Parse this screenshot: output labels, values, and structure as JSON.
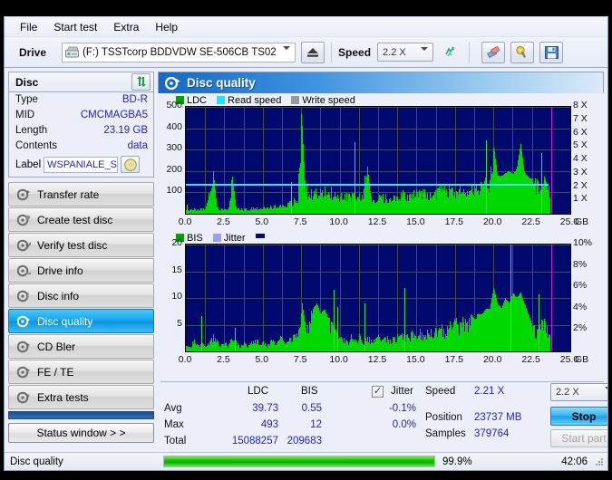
{
  "menu": {
    "items": [
      "File",
      "Start test",
      "Extra",
      "Help"
    ]
  },
  "toolbar": {
    "drive_label": "Drive",
    "drive_value": "(F:)  TSSTcorp BDDVDW SE-506CB TS02",
    "speed_label": "Speed",
    "speed_value": "2.2 X",
    "eject_icon": "eject-icon",
    "refresh_icon": "refresh-icon",
    "erase_icon": "erase-icon",
    "settings_icon": "settings-icon",
    "save_icon": "save-icon"
  },
  "disc": {
    "title": "Disc",
    "refresh_icon": "disc-refresh-icon",
    "rows": [
      {
        "key": "Type",
        "value": "BD-R"
      },
      {
        "key": "MID",
        "value": "CMCMAGBA5"
      },
      {
        "key": "Length",
        "value": "23.19 GB"
      },
      {
        "key": "Contents",
        "value": "data"
      }
    ],
    "label_key": "Label",
    "label_value": "WSPANIALE_S",
    "label_icon": "cd-icon"
  },
  "sidebar": {
    "items": [
      {
        "label": "Transfer rate",
        "icon": "disc-transfer-icon",
        "selected": false
      },
      {
        "label": "Create test disc",
        "icon": "disc-create-icon",
        "selected": false
      },
      {
        "label": "Verify test disc",
        "icon": "disc-verify-icon",
        "selected": false
      },
      {
        "label": "Drive info",
        "icon": "drive-info-icon",
        "selected": false
      },
      {
        "label": "Disc info",
        "icon": "disc-info-icon",
        "selected": false
      },
      {
        "label": "Disc quality",
        "icon": "disc-quality-icon",
        "selected": true
      },
      {
        "label": "CD Bler",
        "icon": "cd-bler-icon",
        "selected": false
      },
      {
        "label": "FE / TE",
        "icon": "fe-te-icon",
        "selected": false
      },
      {
        "label": "Extra tests",
        "icon": "extra-tests-icon",
        "selected": false
      }
    ],
    "status_window_button": "Status window > >"
  },
  "panel": {
    "title": "Disc quality",
    "title_icon": "disc-quality-icon"
  },
  "stats": {
    "col_ldc": "LDC",
    "col_bis": "BIS",
    "col_jitter": "Jitter",
    "jitter_checked": true,
    "rows": [
      {
        "name": "Avg",
        "ldc": "39.73",
        "bis": "0.55",
        "jitter": "-0.1%"
      },
      {
        "name": "Max",
        "ldc": "493",
        "bis": "12",
        "jitter": "0.0%"
      },
      {
        "name": "Total",
        "ldc": "15088257",
        "bis": "209683",
        "jitter": ""
      }
    ],
    "speed_key": "Speed",
    "speed_value": "2.21 X",
    "position_key": "Position",
    "position_value": "23737 MB",
    "samples_key": "Samples",
    "samples_value": "379764",
    "speed_select": "2.2 X",
    "stop_button": "Stop",
    "start_part_button": "Start part"
  },
  "statusbar": {
    "text": "Disc quality",
    "percent": "99.9%",
    "progress": 99.9,
    "time": "42:06"
  },
  "colors": {
    "ldc": "#00d900",
    "bis": "#2bd400",
    "read_speed": "#3fe0ff",
    "write_speed": "#9a9a9a",
    "jitter": "#9aa0f0",
    "plot_bg": "#000a6e",
    "accent": "#1668c2",
    "value_text": "#2222cc"
  },
  "chart_data": [
    {
      "type": "area",
      "title": "LDC",
      "xlabel": "GB",
      "ylabel": "LDC",
      "xlim": [
        0,
        25
      ],
      "ylim": [
        0,
        500
      ],
      "y2lim": [
        0,
        8
      ],
      "y2label": "X",
      "xticks": [
        "0.0",
        "2.5",
        "5.0",
        "7.5",
        "10.0",
        "12.5",
        "15.0",
        "17.5",
        "20.0",
        "22.5",
        "25.0"
      ],
      "yticks": [
        100,
        200,
        300,
        400,
        500
      ],
      "y2ticks": [
        "1 X",
        "2 X",
        "3 X",
        "4 X",
        "5 X",
        "6 X",
        "7 X",
        "8 X"
      ],
      "x_unit_label": "GB",
      "grid": true,
      "legend": [
        {
          "name": "LDC",
          "color": "#00a000"
        },
        {
          "name": "Read speed",
          "color": "#18e8ff"
        },
        {
          "name": "Write speed",
          "color": "#9a9a9a"
        }
      ],
      "legend_position": "top-left",
      "read_speed_constant": 2.21,
      "cursor_x": 23.74,
      "series": [
        {
          "name": "LDC",
          "x": [
            0.0,
            0.25,
            0.5,
            0.75,
            1.0,
            1.25,
            1.5,
            1.75,
            2.0,
            2.25,
            2.5,
            2.75,
            3.0,
            3.25,
            3.5,
            3.75,
            4.0,
            4.25,
            4.5,
            4.75,
            5.0,
            5.25,
            5.5,
            5.75,
            6.0,
            6.25,
            6.5,
            6.75,
            7.0,
            7.25,
            7.5,
            7.75,
            8.0,
            8.25,
            8.5,
            8.75,
            9.0,
            9.25,
            9.5,
            9.75,
            10.0,
            10.25,
            10.5,
            10.75,
            11.0,
            11.25,
            11.5,
            11.75,
            12.0,
            12.25,
            12.5,
            12.75,
            13.0,
            13.25,
            13.5,
            13.75,
            14.0,
            14.25,
            14.5,
            14.75,
            15.0,
            15.25,
            15.5,
            15.75,
            16.0,
            16.25,
            16.5,
            16.75,
            17.0,
            17.25,
            17.5,
            17.75,
            18.0,
            18.25,
            18.5,
            18.75,
            19.0,
            19.25,
            19.5,
            19.75,
            20.0,
            20.25,
            20.5,
            20.75,
            21.0,
            21.25,
            21.5,
            21.75,
            22.0,
            22.25,
            22.5,
            22.75,
            23.0,
            23.25,
            23.5,
            23.74
          ],
          "values": [
            18,
            20,
            22,
            20,
            24,
            22,
            95,
            215,
            30,
            24,
            22,
            26,
            180,
            28,
            26,
            24,
            22,
            26,
            28,
            30,
            32,
            30,
            34,
            36,
            38,
            42,
            46,
            52,
            60,
            75,
            480,
            120,
            115,
            110,
            130,
            125,
            140,
            118,
            112,
            105,
            100,
            98,
            95,
            92,
            90,
            88,
            86,
            250,
            84,
            86,
            88,
            90,
            86,
            84,
            88,
            92,
            96,
            98,
            102,
            100,
            104,
            108,
            106,
            110,
            112,
            108,
            114,
            118,
            116,
            120,
            124,
            128,
            126,
            130,
            134,
            138,
            140,
            145,
            150,
            160,
            320,
            180,
            175,
            190,
            200,
            185,
            210,
            330,
            195,
            170,
            160,
            140,
            150,
            180,
            130,
            120
          ]
        },
        {
          "name": "Read speed",
          "x": [
            0.0,
            23.6
          ],
          "values": [
            2.21,
            2.21
          ],
          "color": "#3fe0ff"
        }
      ]
    },
    {
      "type": "area",
      "title": "BIS",
      "xlabel": "GB",
      "ylabel": "BIS",
      "xlim": [
        0,
        25
      ],
      "ylim": [
        0,
        20
      ],
      "y2lim": [
        0,
        10
      ],
      "y2label": "%",
      "xticks": [
        "0.0",
        "2.5",
        "5.0",
        "7.5",
        "10.0",
        "12.5",
        "15.0",
        "17.5",
        "20.0",
        "22.5",
        "25.0"
      ],
      "yticks": [
        5,
        10,
        15,
        20
      ],
      "y2ticks": [
        "2%",
        "4%",
        "6%",
        "8%",
        "10%"
      ],
      "x_unit_label": "GB",
      "grid": true,
      "legend": [
        {
          "name": "BIS",
          "color": "#00a000"
        },
        {
          "name": "Jitter",
          "color": "#9aa0f0"
        }
      ],
      "legend_position": "top-left",
      "cursor_x": 23.74,
      "series": [
        {
          "name": "BIS",
          "x": [
            0.0,
            0.25,
            0.5,
            0.75,
            1.0,
            1.25,
            1.5,
            1.75,
            2.0,
            2.25,
            2.5,
            2.75,
            3.0,
            3.25,
            3.5,
            3.75,
            4.0,
            4.25,
            4.5,
            4.75,
            5.0,
            5.25,
            5.5,
            5.75,
            6.0,
            6.25,
            6.5,
            6.75,
            7.0,
            7.25,
            7.5,
            7.75,
            8.0,
            8.25,
            8.5,
            8.75,
            9.0,
            9.25,
            9.5,
            9.75,
            10.0,
            10.25,
            10.5,
            10.75,
            11.0,
            11.25,
            11.5,
            11.75,
            12.0,
            12.25,
            12.5,
            12.75,
            13.0,
            13.25,
            13.5,
            13.75,
            14.0,
            14.25,
            14.5,
            14.75,
            15.0,
            15.25,
            15.5,
            15.75,
            16.0,
            16.25,
            16.5,
            16.75,
            17.0,
            17.25,
            17.5,
            17.75,
            18.0,
            18.25,
            18.5,
            18.75,
            19.0,
            19.25,
            19.5,
            19.75,
            20.0,
            20.25,
            20.5,
            20.75,
            21.0,
            21.25,
            21.5,
            21.75,
            22.0,
            22.25,
            22.5,
            22.75,
            23.0,
            23.25,
            23.5,
            23.74
          ],
          "values": [
            1,
            1,
            2,
            1,
            2,
            1,
            2,
            3,
            2,
            1,
            2,
            1,
            3,
            2,
            1,
            2,
            1,
            2,
            2,
            2,
            2,
            1,
            2,
            2,
            2,
            3,
            2,
            3,
            3,
            4,
            10,
            5,
            6,
            8,
            9,
            7,
            8,
            6,
            5,
            4,
            3,
            3,
            2,
            3,
            2,
            3,
            2,
            3,
            2,
            3,
            3,
            2,
            3,
            2,
            3,
            3,
            3,
            3,
            3,
            4,
            3,
            4,
            3,
            4,
            4,
            4,
            5,
            4,
            5,
            5,
            6,
            5,
            6,
            6,
            7,
            6,
            7,
            7,
            8,
            8,
            12,
            9,
            8,
            10,
            9,
            11,
            10,
            11,
            9,
            7,
            5,
            4,
            5,
            6,
            4,
            3
          ]
        }
      ]
    }
  ]
}
